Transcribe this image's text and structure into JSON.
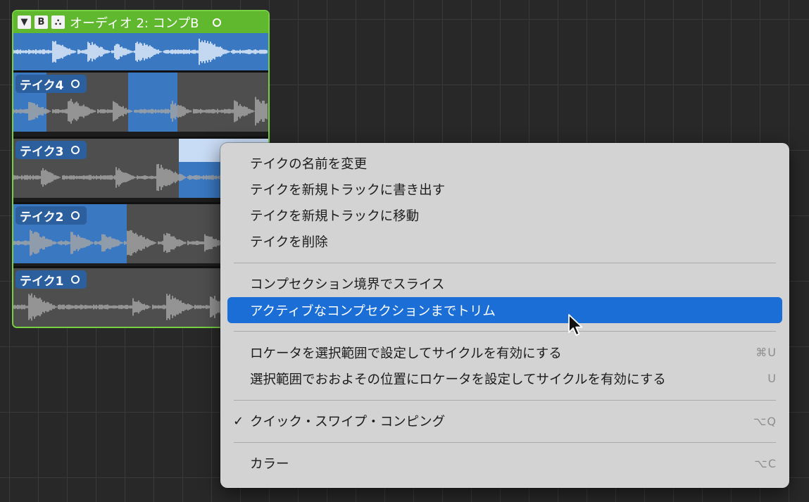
{
  "take_folder": {
    "title": "オーディオ 2: コンプB",
    "disclosure_glyph": "▼",
    "badge_label": "B",
    "quick_swipe_glyph": "⛬",
    "takes": [
      {
        "label": "テイク4"
      },
      {
        "label": "テイク3"
      },
      {
        "label": "テイク2"
      },
      {
        "label": "テイク1"
      }
    ]
  },
  "context_menu": {
    "groups": [
      [
        {
          "label": "テイクの名前を変更"
        },
        {
          "label": "テイクを新規トラックに書き出す"
        },
        {
          "label": "テイクを新規トラックに移動"
        },
        {
          "label": "テイクを削除"
        }
      ],
      [
        {
          "label": "コンプセクション境界でスライス"
        },
        {
          "label": "アクティブなコンプセクションまでトリム",
          "highlighted": true
        }
      ],
      [
        {
          "label": "ロケータを選択範囲で設定してサイクルを有効にする",
          "shortcut": "⌘U"
        },
        {
          "label": "選択範囲でおおよその位置にロケータを設定してサイクルを有効にする",
          "shortcut": "U"
        }
      ],
      [
        {
          "label": "クイック・スワイプ・コンピング",
          "checked": true,
          "check_glyph": "✓",
          "shortcut": "⌥Q"
        }
      ],
      [
        {
          "label": "カラー",
          "shortcut": "⌥C"
        }
      ]
    ]
  },
  "colors": {
    "folder_border": "#76d143",
    "folder_header": "#60b82f",
    "selection_blue": "#3a78c2",
    "take_label_bg": "#2b5f9e",
    "menu_bg": "#d3d3d3",
    "menu_highlight": "#1a6ed6",
    "waveform_gray": "#a5a5a5",
    "waveform_light": "#e6f0fb"
  },
  "icons": {
    "cursor": "arrow-pointer-icon",
    "take_status": "circle-icon"
  }
}
